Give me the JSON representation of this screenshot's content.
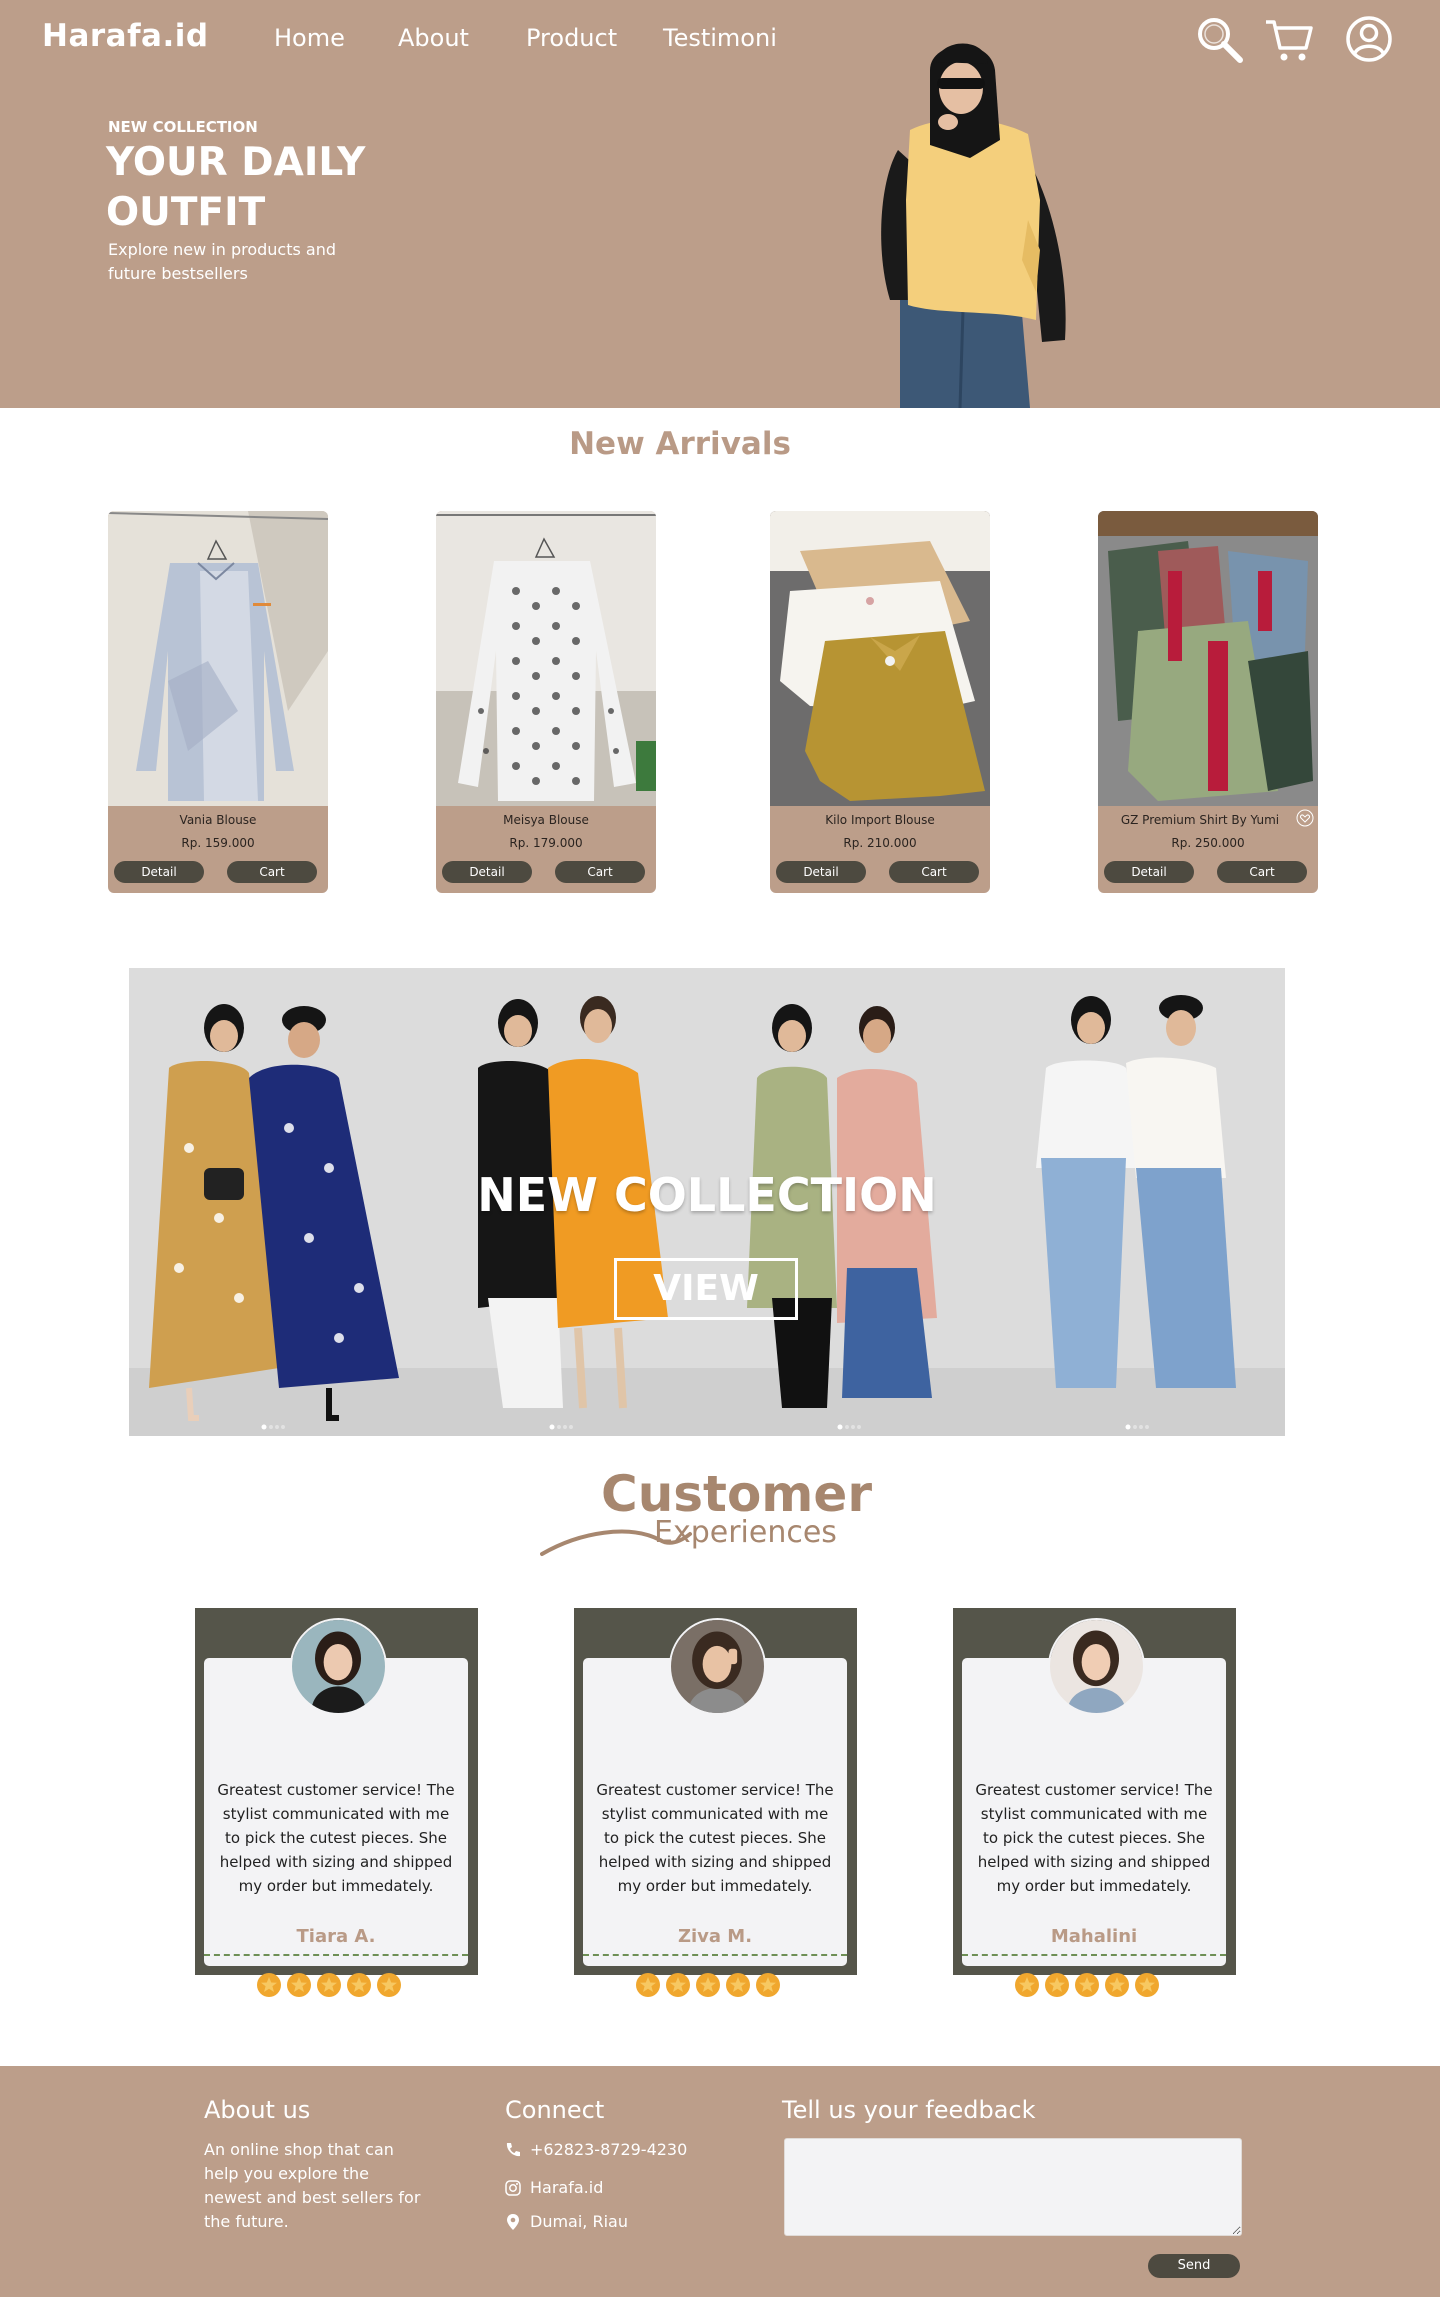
{
  "brand": {
    "logo": "Harafa.id"
  },
  "nav": {
    "items": [
      "Home",
      "About",
      "Product",
      "Testimoni"
    ]
  },
  "header_icons": [
    "search-icon",
    "cart-icon",
    "account-icon"
  ],
  "hero": {
    "kicker": "NEW COLLECTION",
    "title": "YOUR DAILY OUTFIT",
    "subtitle": "Explore new in products and future bestsellers"
  },
  "new_arrivals": {
    "title": "New Arrivals",
    "products": [
      {
        "name": "Vania Blouse",
        "price": "Rp. 159.000",
        "detail_label": "Detail",
        "cart_label": "Cart"
      },
      {
        "name": "Meisya Blouse",
        "price": "Rp. 179.000",
        "detail_label": "Detail",
        "cart_label": "Cart"
      },
      {
        "name": "Kilo Import Blouse",
        "price": "Rp. 210.000",
        "detail_label": "Detail",
        "cart_label": "Cart"
      },
      {
        "name": "GZ Premium Shirt By Yumi",
        "price": "Rp. 250.000",
        "detail_label": "Detail",
        "cart_label": "Cart"
      }
    ]
  },
  "banner": {
    "title": "NEW COLLECTION",
    "view_label": "VIEW"
  },
  "customer": {
    "title": "Customer",
    "subtitle": "Experiences",
    "testimonials": [
      {
        "quote": "Greatest customer service! The stylist communicated with me to pick the cutest pieces. She helped with sizing and shipped my order but immedately.",
        "name": "Tiara A.",
        "rating": 5
      },
      {
        "quote": "Greatest customer service! The stylist communicated with me to pick the cutest pieces. She helped with sizing and shipped my order but immedately.",
        "name": "Ziva M.",
        "rating": 5
      },
      {
        "quote": "Greatest customer service! The stylist communicated with me to pick the cutest pieces. She helped with sizing and shipped my order but immedately.",
        "name": "Mahalini",
        "rating": 5
      }
    ]
  },
  "footer": {
    "about_title": "About us",
    "about_text": "An online shop that can help you explore the newest and best sellers for the future.",
    "connect_title": "Connect",
    "phone": "+62823-8729-4230",
    "instagram": "Harafa.id",
    "location": "Dumai, Riau",
    "feedback_title": "Tell us your feedback",
    "send_label": "Send"
  },
  "colors": {
    "brand": "#bc9e8a",
    "accent_text": "#b99a86",
    "button": "#4d4a40",
    "testimonial_frame": "#55554a",
    "star": "#f0a72e"
  }
}
